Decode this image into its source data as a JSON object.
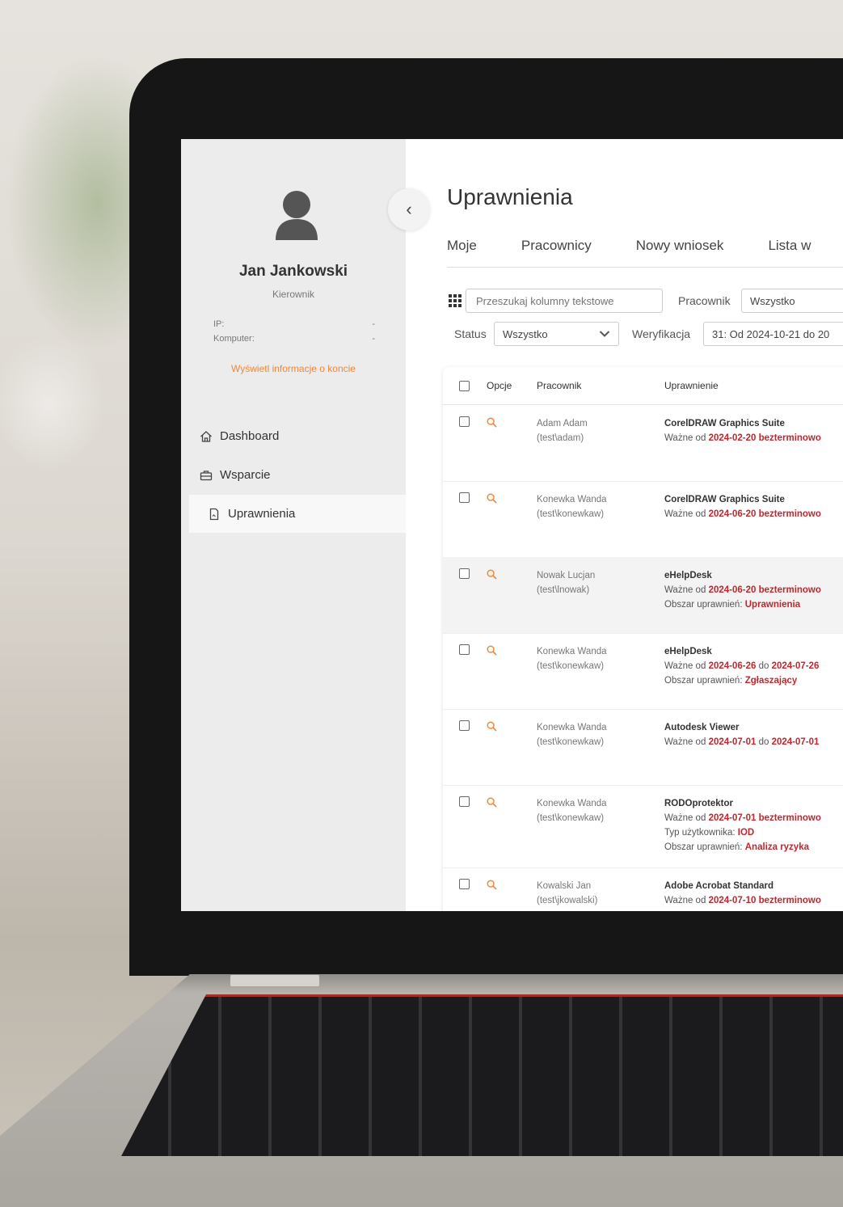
{
  "user": {
    "name": "Jan Jankowski",
    "role": "Kierownik",
    "ip_label": "IP:",
    "ip_value": "-",
    "computer_label": "Komputer:",
    "computer_value": "-",
    "account_link": "Wyświetl informacje o koncie"
  },
  "nav": {
    "items": [
      {
        "label": "Dashboard",
        "icon": "home-icon"
      },
      {
        "label": "Wsparcie",
        "icon": "toolbox-icon"
      },
      {
        "label": "Uprawnienia",
        "icon": "document-icon"
      }
    ]
  },
  "page": {
    "title": "Uprawnienia",
    "tabs": [
      "Moje",
      "Pracownicy",
      "Nowy wniosek",
      "Lista w"
    ]
  },
  "filters": {
    "search_placeholder": "Przeszukaj kolumny tekstowe",
    "employee_label": "Pracownik",
    "employee_value": "Wszystko",
    "status_label": "Status",
    "status_value": "Wszystko",
    "verification_label": "Weryfikacja",
    "verification_value": "31: Od 2024-10-21 do 20"
  },
  "table": {
    "headers": {
      "options": "Opcje",
      "employee": "Pracownik",
      "permission": "Uprawnienie"
    },
    "rows": [
      {
        "name": "Adam Adam",
        "login": "(test\\adam)",
        "perm": "CorelDRAW Graphics Suite",
        "valid_prefix": "Ważne od",
        "from": "2024-02-20",
        "mid": "",
        "to": "bezterminowo"
      },
      {
        "name": "Konewka Wanda",
        "login": "(test\\konewkaw)",
        "perm": "CorelDRAW Graphics Suite",
        "valid_prefix": "Ważne od",
        "from": "2024-06-20",
        "mid": "",
        "to": "bezterminowo"
      },
      {
        "name": "Nowak Lucjan",
        "login": "(test\\lnowak)",
        "perm": "eHelpDesk",
        "valid_prefix": "Ważne od",
        "from": "2024-06-20",
        "mid": "",
        "to": "bezterminowo",
        "extra1_label": "Obszar uprawnień:",
        "extra1_value": "Uprawnienia"
      },
      {
        "name": "Konewka Wanda",
        "login": "(test\\konewkaw)",
        "perm": "eHelpDesk",
        "valid_prefix": "Ważne od",
        "from": "2024-06-26",
        "mid": "do",
        "to": "2024-07-26",
        "extra1_label": "Obszar uprawnień:",
        "extra1_value": "Zgłaszający"
      },
      {
        "name": "Konewka Wanda",
        "login": "(test\\konewkaw)",
        "perm": "Autodesk Viewer",
        "valid_prefix": "Ważne od",
        "from": "2024-07-01",
        "mid": "do",
        "to": "2024-07-01"
      },
      {
        "name": "Konewka Wanda",
        "login": "(test\\konewkaw)",
        "perm": "RODOprotektor",
        "valid_prefix": "Ważne od",
        "from": "2024-07-01",
        "mid": "",
        "to": "bezterminowo",
        "extra1_label": "Typ użytkownika:",
        "extra1_value": "IOD",
        "extra2_label": "Obszar uprawnień:",
        "extra2_value": "Analiza ryzyka"
      },
      {
        "name": "Kowalski Jan",
        "login": "(test\\jkowalski)",
        "perm": "Adobe Acrobat Standard",
        "valid_prefix": "Ważne od",
        "from": "2024-07-10",
        "mid": "",
        "to": "bezterminowo"
      }
    ]
  },
  "colors": {
    "accent_orange": "#f0883a",
    "date_red": "#c0272d"
  }
}
